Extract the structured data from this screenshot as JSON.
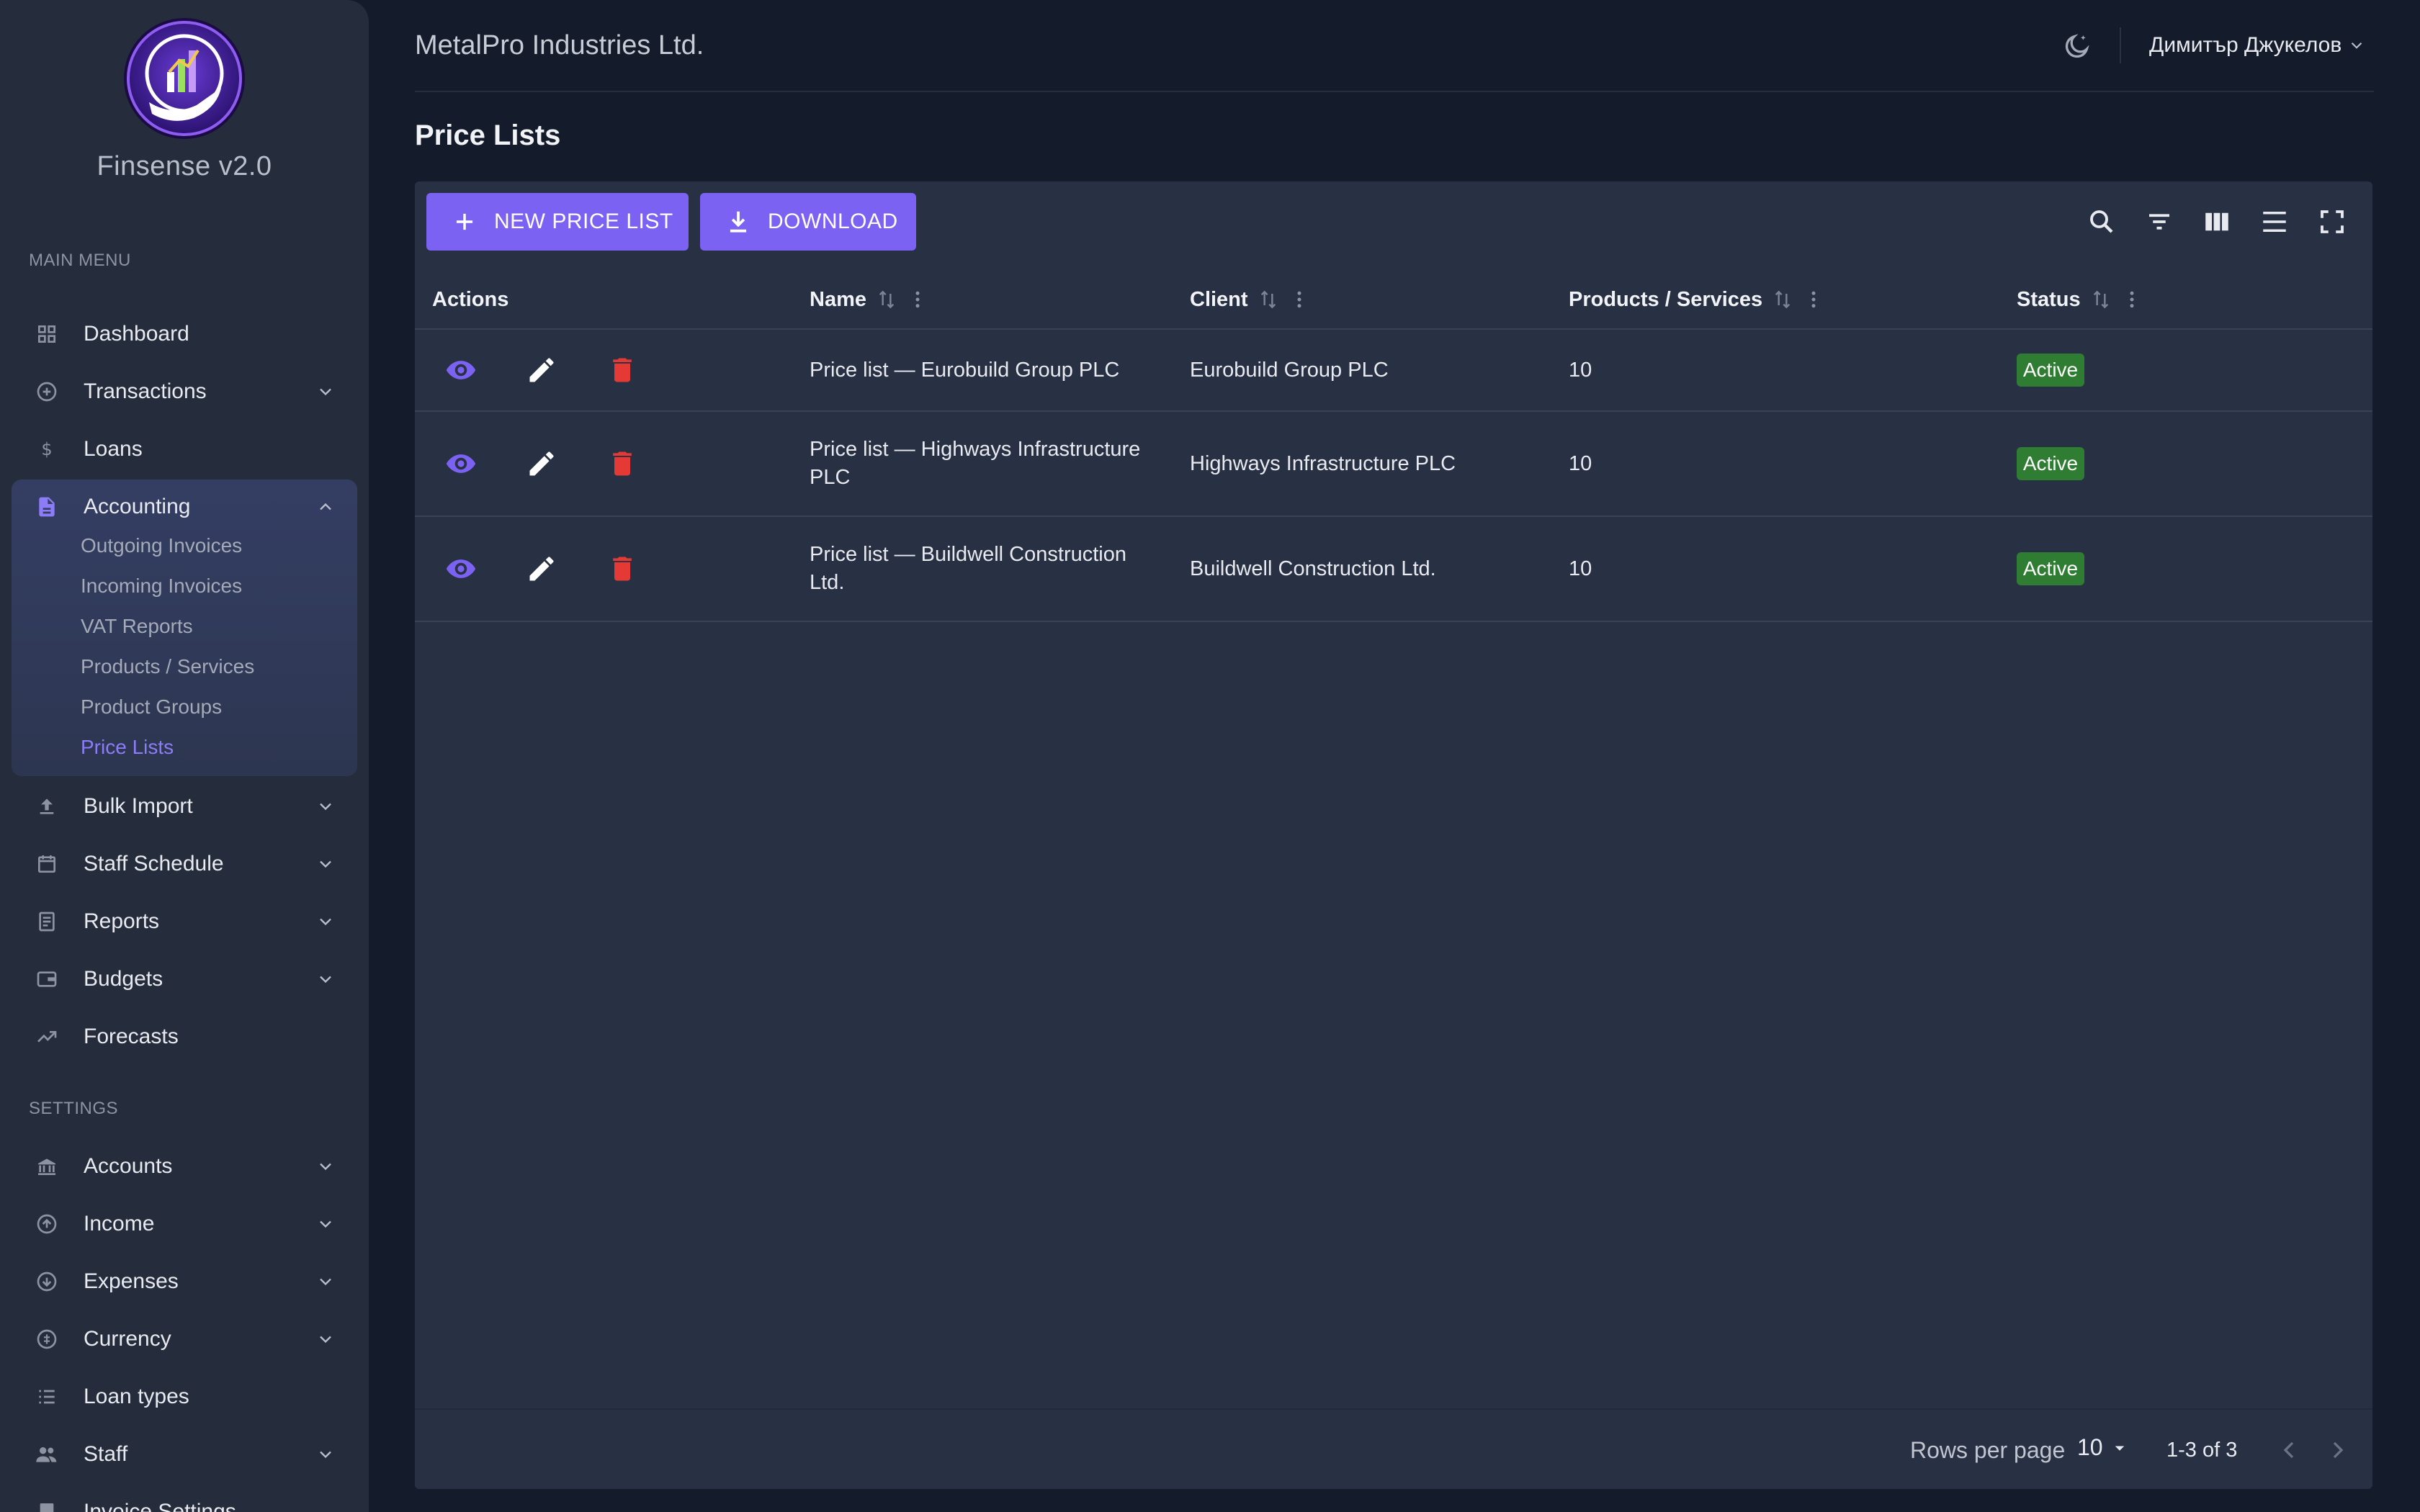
{
  "brand": {
    "name": "Finsense v2.0"
  },
  "sidebar": {
    "main_menu_title": "MAIN MENU",
    "settings_title": "SETTINGS",
    "items": [
      {
        "label": "Dashboard",
        "icon": "dashboard-icon"
      },
      {
        "label": "Transactions",
        "icon": "circle-plus-icon"
      },
      {
        "label": "Loans",
        "icon": "dollar-icon"
      },
      {
        "label": "Accounting",
        "icon": "document-icon"
      },
      {
        "label": "Bulk Import",
        "icon": "upload-icon"
      },
      {
        "label": "Staff Schedule",
        "icon": "calendar-icon"
      },
      {
        "label": "Reports",
        "icon": "report-icon"
      },
      {
        "label": "Budgets",
        "icon": "wallet-icon"
      },
      {
        "label": "Forecasts",
        "icon": "trending-up-icon"
      }
    ],
    "accounting_sub": [
      "Outgoing Invoices",
      "Incoming Invoices",
      "VAT Reports",
      "Products / Services",
      "Product Groups",
      "Price Lists"
    ],
    "settings_items": [
      {
        "label": "Accounts",
        "icon": "bank-icon"
      },
      {
        "label": "Income",
        "icon": "arrow-up-circle-icon"
      },
      {
        "label": "Expenses",
        "icon": "arrow-down-circle-icon"
      },
      {
        "label": "Currency",
        "icon": "currency-icon"
      },
      {
        "label": "Loan types",
        "icon": "list-icon"
      },
      {
        "label": "Staff",
        "icon": "people-icon"
      },
      {
        "label": "Invoice Settings",
        "icon": "receipt-icon"
      }
    ]
  },
  "header": {
    "company": "MetalPro Industries Ltd.",
    "user": "Димитър Джукелов"
  },
  "page": {
    "title": "Price Lists"
  },
  "toolbar": {
    "new_label": "NEW PRICE LIST",
    "download_label": "DOWNLOAD"
  },
  "table": {
    "columns": [
      "Actions",
      "Name",
      "Client",
      "Products / Services",
      "Status"
    ],
    "rows": [
      {
        "name": "Price list — Eurobuild Group PLC",
        "client": "Eurobuild Group PLC",
        "products": "10",
        "status": "Active"
      },
      {
        "name": "Price list — Highways Infrastructure PLC",
        "client": "Highways Infrastructure PLC",
        "products": "10",
        "status": "Active"
      },
      {
        "name": "Price list — Buildwell Construction Ltd.",
        "client": "Buildwell Construction Ltd.",
        "products": "10",
        "status": "Active"
      }
    ]
  },
  "pagination": {
    "rows_per_page_label": "Rows per page",
    "rows_per_page": "10",
    "range": "1-3 of 3"
  },
  "colors": {
    "accent": "#7b62f3",
    "active_sub": "#8c7cf8",
    "status_active": "#2e7d32",
    "delete": "#e53935",
    "view": "#7b62f3"
  }
}
